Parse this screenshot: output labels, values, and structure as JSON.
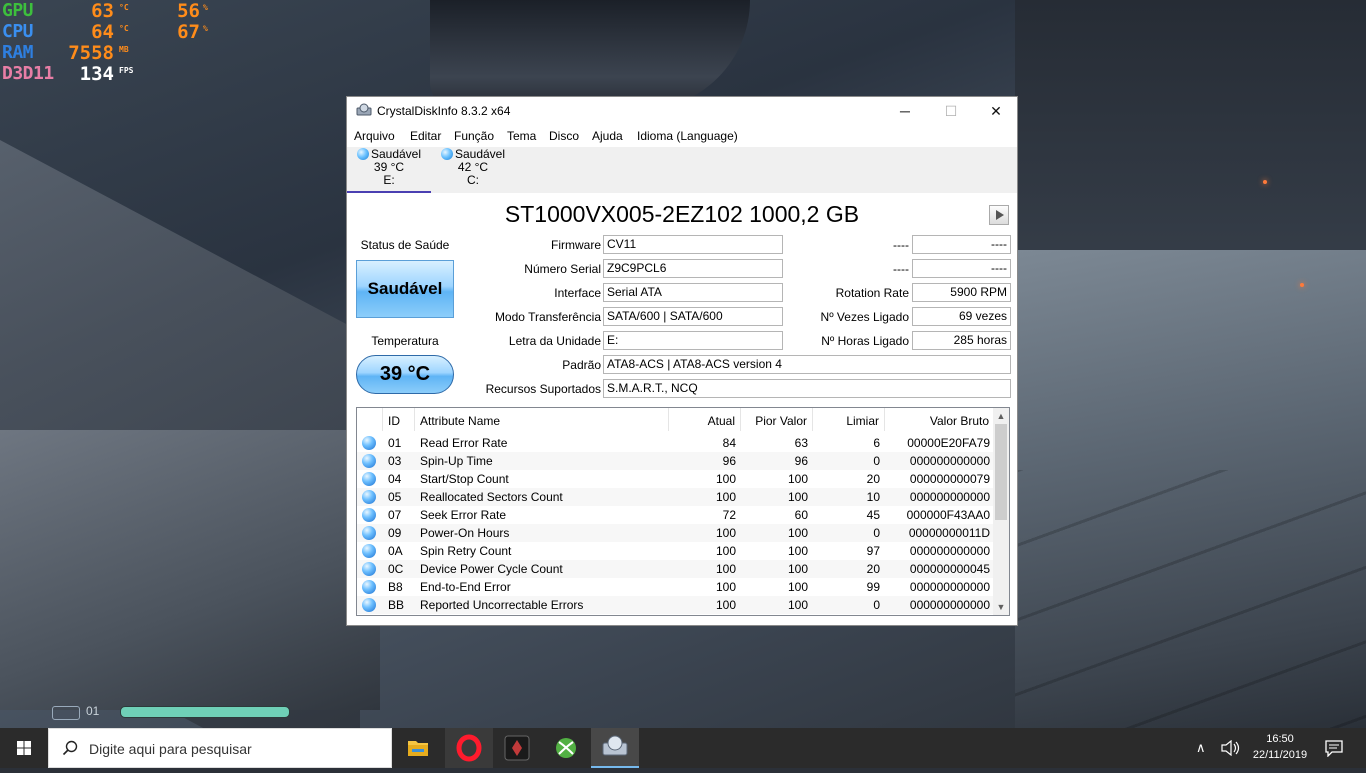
{
  "overlay": {
    "gpu": {
      "label": "GPU",
      "temp": "63",
      "temp_unit": "°C",
      "load": "56",
      "load_unit": "%",
      "label_color": "#3dbf3d"
    },
    "cpu": {
      "label": "CPU",
      "temp": "64",
      "temp_unit": "°C",
      "load": "67",
      "load_unit": "%",
      "label_color": "#3a8ff0"
    },
    "ram": {
      "label": "RAM",
      "value": "7558",
      "unit": "MB",
      "label_color": "#2e7fe0"
    },
    "d3d": {
      "label": "D3D11",
      "value": "134",
      "unit": "FPS",
      "label_color": "#e87ea6"
    }
  },
  "window": {
    "title": "CrystalDiskInfo 8.3.2 x64",
    "minimize": "─",
    "maximize": "☐",
    "close": "✕",
    "menu": [
      "Arquivo",
      "Editar",
      "Função",
      "Tema",
      "Disco",
      "Ajuda",
      "Idioma (Language)"
    ],
    "disks": [
      {
        "status": "Saudável",
        "temp": "39 °C",
        "letter": "E:"
      },
      {
        "status": "Saudável",
        "temp": "42 °C",
        "letter": "C:"
      }
    ],
    "model": "ST1000VX005-2EZ102 1000,2 GB",
    "health_label": "Status de Saúde",
    "health_value": "Saudável",
    "temp_label": "Temperatura",
    "temp_value": "39 °C",
    "fields": {
      "firmware_label": "Firmware",
      "firmware": "CV11",
      "serial_label": "Número Serial",
      "serial": "Z9C9PCL6",
      "interface_label": "Interface",
      "interface": "Serial ATA",
      "transfer_label": "Modo Transferência",
      "transfer": "SATA/600 | SATA/600",
      "letter_label": "Letra da Unidade",
      "letter": "E:",
      "standard_label": "Padrão",
      "standard": "ATA8-ACS | ATA8-ACS version 4",
      "features_label": "Recursos Suportados",
      "features": "S.M.A.R.T., NCQ",
      "right1_label": "----",
      "right1": "----",
      "right2_label": "----",
      "right2": "----",
      "rotation_label": "Rotation Rate",
      "rotation": "5900 RPM",
      "powercount_label": "Nº Vezes Ligado",
      "powercount": "69 vezes",
      "powerhours_label": "Nº Horas Ligado",
      "powerhours": "285 horas"
    },
    "table": {
      "headers": [
        "ID",
        "Attribute Name",
        "Atual",
        "Pior Valor",
        "Limiar",
        "Valor Bruto"
      ],
      "rows": [
        [
          "01",
          "Read Error Rate",
          "84",
          "63",
          "6",
          "00000E20FA79"
        ],
        [
          "03",
          "Spin-Up Time",
          "96",
          "96",
          "0",
          "000000000000"
        ],
        [
          "04",
          "Start/Stop Count",
          "100",
          "100",
          "20",
          "000000000079"
        ],
        [
          "05",
          "Reallocated Sectors Count",
          "100",
          "100",
          "10",
          "000000000000"
        ],
        [
          "07",
          "Seek Error Rate",
          "72",
          "60",
          "45",
          "000000F43AA0"
        ],
        [
          "09",
          "Power-On Hours",
          "100",
          "100",
          "0",
          "00000000011D"
        ],
        [
          "0A",
          "Spin Retry Count",
          "100",
          "100",
          "97",
          "000000000000"
        ],
        [
          "0C",
          "Device Power Cycle Count",
          "100",
          "100",
          "20",
          "000000000045"
        ],
        [
          "B8",
          "End-to-End Error",
          "100",
          "100",
          "99",
          "000000000000"
        ],
        [
          "BB",
          "Reported Uncorrectable Errors",
          "100",
          "100",
          "0",
          "000000000000"
        ]
      ]
    }
  },
  "hud": {
    "count": "01"
  },
  "taskbar": {
    "search_placeholder": "Digite aqui para pesquisar",
    "time": "16:50",
    "date": "22/11/2019"
  }
}
